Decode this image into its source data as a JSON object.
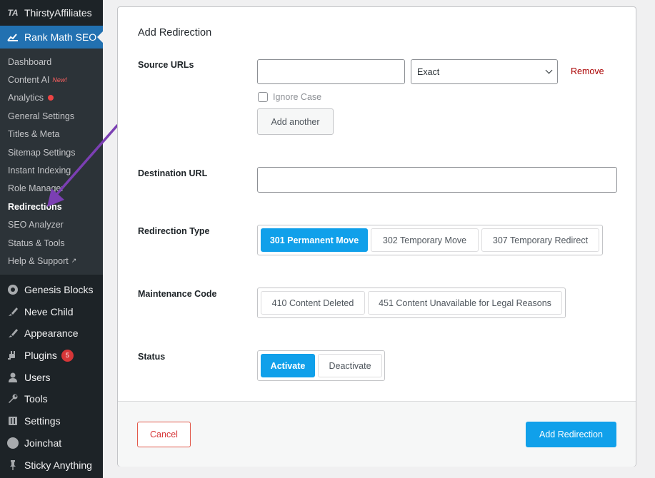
{
  "sidebar": {
    "top_item": {
      "label": "ThirstyAffiliates",
      "icon": "thirstyaffiliates-icon"
    },
    "current": {
      "label": "Rank Math SEO",
      "icon": "rank-math-icon"
    },
    "submenu": [
      {
        "label": "Dashboard"
      },
      {
        "label": "Content AI",
        "badge": "New!"
      },
      {
        "label": "Analytics"
      },
      {
        "label": "General Settings"
      },
      {
        "label": "Titles & Meta"
      },
      {
        "label": "Sitemap Settings"
      },
      {
        "label": "Instant Indexing"
      },
      {
        "label": "Role Manager"
      },
      {
        "label": "Redirections"
      },
      {
        "label": "SEO Analyzer"
      },
      {
        "label": "Status & Tools"
      },
      {
        "label": "Help & Support"
      }
    ],
    "lower": [
      {
        "label": "Genesis Blocks",
        "icon": "genesis-blocks-icon"
      },
      {
        "label": "Neve Child",
        "icon": "paintbrush-icon"
      },
      {
        "label": "Appearance",
        "icon": "paintbrush-icon"
      },
      {
        "label": "Plugins",
        "icon": "plugin-icon",
        "count": "5"
      },
      {
        "label": "Users",
        "icon": "user-icon"
      },
      {
        "label": "Tools",
        "icon": "wrench-icon"
      },
      {
        "label": "Settings",
        "icon": "settings-icon"
      },
      {
        "label": "Joinchat",
        "icon": "chat-icon"
      },
      {
        "label": "Sticky Anything",
        "icon": "pin-icon"
      }
    ]
  },
  "form": {
    "title": "Add Redirection",
    "source_label": "Source URLs",
    "source_value": "",
    "match_type": "Exact",
    "remove_label": "Remove",
    "ignore_case_label": "Ignore Case",
    "add_another_label": "Add another",
    "destination_label": "Destination URL",
    "destination_value": "",
    "redirection_type_label": "Redirection Type",
    "redirection_types": [
      "301 Permanent Move",
      "302 Temporary Move",
      "307 Temporary Redirect"
    ],
    "maintenance_label": "Maintenance Code",
    "maintenance_codes": [
      "410 Content Deleted",
      "451 Content Unavailable for Legal Reasons"
    ],
    "status_label": "Status",
    "status_options": [
      "Activate",
      "Deactivate"
    ]
  },
  "footer": {
    "cancel_label": "Cancel",
    "submit_label": "Add Redirection"
  },
  "colors": {
    "sidebar_bg": "#1d2327",
    "current_menu": "#2271b1",
    "accent": "#10a0ea",
    "danger": "#d63638",
    "annotation_arrow": "#7b3fb3"
  }
}
